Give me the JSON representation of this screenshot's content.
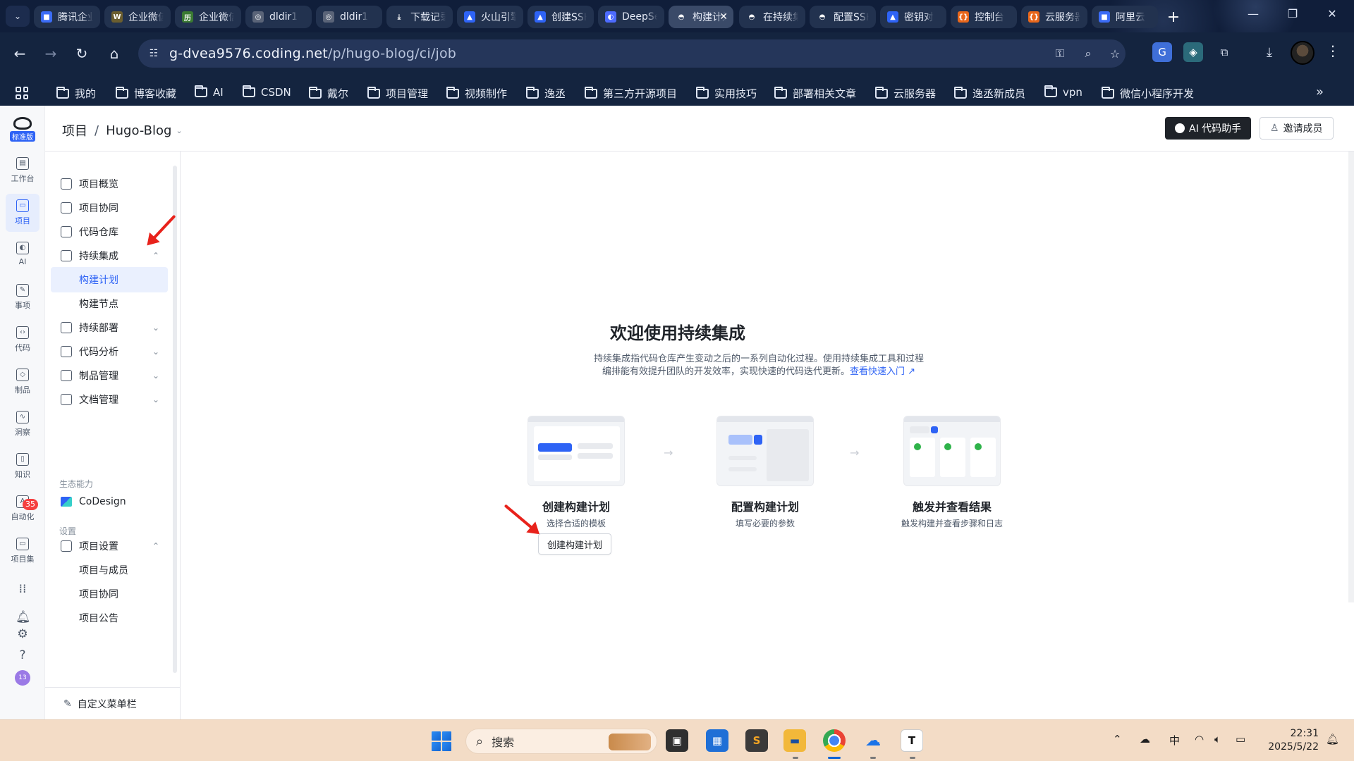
{
  "browser": {
    "tabs": [
      {
        "title": "腾讯企业邮",
        "fav_color": "#3b6cf6",
        "fav_glyph": "■"
      },
      {
        "title": "企业微信",
        "fav_color": "#6b5e2f",
        "fav_glyph": "W"
      },
      {
        "title": "企业微信",
        "fav_color": "#3a7a32",
        "fav_glyph": "历"
      },
      {
        "title": "dldir1",
        "fav_color": "#5a6478",
        "fav_glyph": "◎"
      },
      {
        "title": "dldir1",
        "fav_color": "#5a6478",
        "fav_glyph": "◎"
      },
      {
        "title": "下载记录",
        "fav_color": "#22324f",
        "fav_glyph": "⤓"
      },
      {
        "title": "火山引擎",
        "fav_color": "#2e63f5",
        "fav_glyph": "▲"
      },
      {
        "title": "创建SSH",
        "fav_color": "#2e63f5",
        "fav_glyph": "▲"
      },
      {
        "title": "DeepSeek",
        "fav_color": "#4d6bfe",
        "fav_glyph": "◐"
      },
      {
        "title": "构建计划",
        "fav_color": "#3a4a68",
        "fav_glyph": "◓",
        "active": true
      },
      {
        "title": "在持续集成",
        "fav_color": "#22324f",
        "fav_glyph": "◓"
      },
      {
        "title": "配置SSH",
        "fav_color": "#22324f",
        "fav_glyph": "◓"
      },
      {
        "title": "密钥对",
        "fav_color": "#2e63f5",
        "fav_glyph": "▲"
      },
      {
        "title": "控制台",
        "fav_color": "#e8671b",
        "fav_glyph": "{}"
      },
      {
        "title": "云服务器",
        "fav_color": "#e8671b",
        "fav_glyph": "{}"
      },
      {
        "title": "阿里云",
        "fav_color": "#3b6cf6",
        "fav_glyph": "■"
      }
    ],
    "url_host": "g-dvea9576.coding.net",
    "url_path": "/p/hugo-blog/ci/job",
    "bookmarks": [
      "我的",
      "博客收藏",
      "AI",
      "CSDN",
      "戴尔",
      "项目管理",
      "视频制作",
      "逸丞",
      "第三方开源项目",
      "实用技巧",
      "部署相关文章",
      "云服务器",
      "逸丞新成员",
      "vpn",
      "微信小程序开发"
    ]
  },
  "rail": {
    "logo_badge": "标准版",
    "items": [
      {
        "label": "工作台",
        "glyph": "▤"
      },
      {
        "label": "项目",
        "glyph": "▭",
        "active": true
      },
      {
        "label": "AI",
        "glyph": "◐"
      },
      {
        "label": "事项",
        "glyph": "✎"
      },
      {
        "label": "代码",
        "glyph": "‹›"
      },
      {
        "label": "制品",
        "glyph": "◇"
      },
      {
        "label": "洞察",
        "glyph": "∿"
      },
      {
        "label": "知识",
        "glyph": "▯"
      },
      {
        "label": "自动化",
        "glyph": "A"
      },
      {
        "label": "项目集",
        "glyph": "▭"
      }
    ],
    "notification_count": "35",
    "user_initials": "13"
  },
  "header": {
    "crumb_root": "项目",
    "crumb_sep": "/",
    "project_name": "Hugo-Blog",
    "ai_button": "AI 代码助手",
    "invite_button": "邀请成员"
  },
  "sidebar": {
    "items": [
      {
        "label": "项目概览"
      },
      {
        "label": "项目协同"
      },
      {
        "label": "代码仓库"
      },
      {
        "label": "持续集成",
        "chevron": "⌃"
      },
      {
        "label": "构建计划",
        "sub": true,
        "active": true
      },
      {
        "label": "构建节点",
        "sub": true
      },
      {
        "label": "持续部署",
        "chevron": "⌄"
      },
      {
        "label": "代码分析",
        "chevron": "⌄"
      },
      {
        "label": "制品管理",
        "chevron": "⌄"
      },
      {
        "label": "文档管理",
        "chevron": "⌄"
      }
    ],
    "eco_section": "生态能力",
    "codesign": "CoDesign",
    "settings_section": "设置",
    "settings_items": [
      {
        "label": "项目设置",
        "chevron": "⌃"
      },
      {
        "label": "项目与成员",
        "sub": true
      },
      {
        "label": "项目协同",
        "sub": true
      },
      {
        "label": "项目公告",
        "sub": true
      }
    ],
    "footer": "自定义菜单栏"
  },
  "main": {
    "title": "欢迎使用持续集成",
    "desc_line1": "持续集成指代码仓库产生变动之后的一系列自动化过程。使用持续集成工具和过程",
    "desc_line2": "编排能有效提升团队的开发效率，实现快速的代码迭代更新。",
    "desc_link": "查看快速入门",
    "steps": [
      {
        "title": "创建构建计划",
        "sub": "选择合适的模板"
      },
      {
        "title": "配置构建计划",
        "sub": "填写必要的参数"
      },
      {
        "title": "触发并查看结果",
        "sub": "触发构建并查看步骤和日志"
      }
    ],
    "create_button": "创建构建计划"
  },
  "taskbar": {
    "search_placeholder": "搜索",
    "tray_ime": "中",
    "time": "22:31",
    "date": "2025/5/22"
  }
}
